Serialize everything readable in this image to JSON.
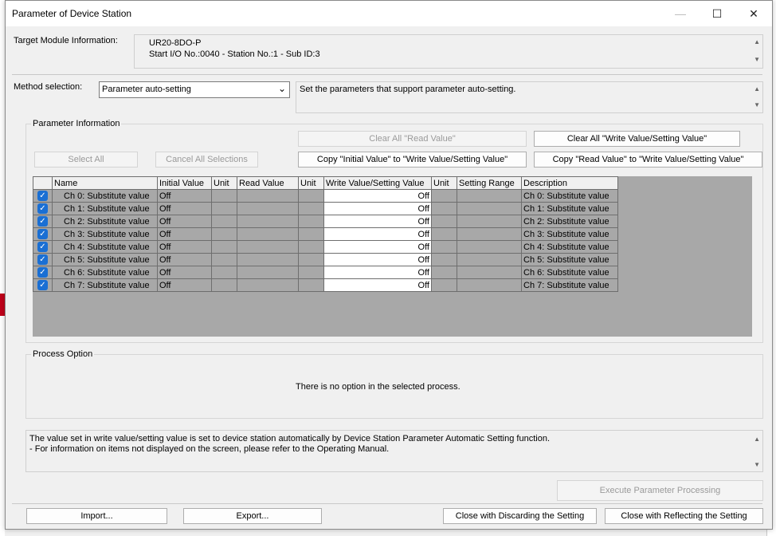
{
  "window": {
    "title": "Parameter of Device Station",
    "minimize": "—",
    "maximize": "☐",
    "close": "✕"
  },
  "target": {
    "label": "Target Module Information:",
    "line1": "UR20-8DO-P",
    "line2": "Start I/O No.:0040 - Station No.:1 - Sub ID:3"
  },
  "method": {
    "label": "Method selection:",
    "selected": "Parameter auto-setting",
    "description": "Set the parameters that support parameter auto-setting."
  },
  "param_info": {
    "label": "Parameter Information",
    "clear_read": "Clear All \"Read Value\"",
    "clear_write": "Clear All \"Write Value/Setting Value\"",
    "select_all": "Select All",
    "cancel_all": "Cancel All Selections",
    "copy_initial": "Copy \"Initial Value\" to \"Write Value/Setting Value\"",
    "copy_read": "Copy \"Read Value\" to \"Write Value/Setting Value\""
  },
  "table": {
    "headers": [
      "",
      "Name",
      "Initial Value",
      "Unit",
      "Read Value",
      "Unit",
      "Write Value/Setting Value",
      "Unit",
      "Setting Range",
      "Description"
    ],
    "rows": [
      {
        "checked": true,
        "name": "Ch 0: Substitute value",
        "initial": "Off",
        "write": "Off",
        "description": "Ch 0: Substitute value"
      },
      {
        "checked": true,
        "name": "Ch 1: Substitute value",
        "initial": "Off",
        "write": "Off",
        "description": "Ch 1: Substitute value"
      },
      {
        "checked": true,
        "name": "Ch 2: Substitute value",
        "initial": "Off",
        "write": "Off",
        "description": "Ch 2: Substitute value"
      },
      {
        "checked": true,
        "name": "Ch 3: Substitute value",
        "initial": "Off",
        "write": "Off",
        "description": "Ch 3: Substitute value"
      },
      {
        "checked": true,
        "name": "Ch 4: Substitute value",
        "initial": "Off",
        "write": "Off",
        "description": "Ch 4: Substitute value"
      },
      {
        "checked": true,
        "name": "Ch 5: Substitute value",
        "initial": "Off",
        "write": "Off",
        "description": "Ch 5: Substitute value"
      },
      {
        "checked": true,
        "name": "Ch 6: Substitute value",
        "initial": "Off",
        "write": "Off",
        "description": "Ch 6: Substitute value"
      },
      {
        "checked": true,
        "name": "Ch 7: Substitute value",
        "initial": "Off",
        "write": "Off",
        "description": "Ch 7: Substitute value"
      }
    ]
  },
  "process": {
    "label": "Process Option",
    "message": "There is no option in the selected process."
  },
  "info": {
    "line1": "The value set in write value/setting value is set to device station automatically by Device Station Parameter Automatic Setting function.",
    "line2": "- For information on items not displayed on the screen, please refer to the Operating Manual."
  },
  "buttons": {
    "execute": "Execute Parameter Processing",
    "import": "Import...",
    "export": "Export...",
    "close_discard": "Close with Discarding the Setting",
    "close_reflect": "Close with Reflecting the Setting"
  },
  "icons": {
    "scroll_up": "▲",
    "scroll_down": "▼",
    "dropdown": "⌄",
    "check": "✓"
  },
  "colors": {
    "check_accent": "#1a6fd4",
    "grid_bg": "#a8a8a8"
  }
}
